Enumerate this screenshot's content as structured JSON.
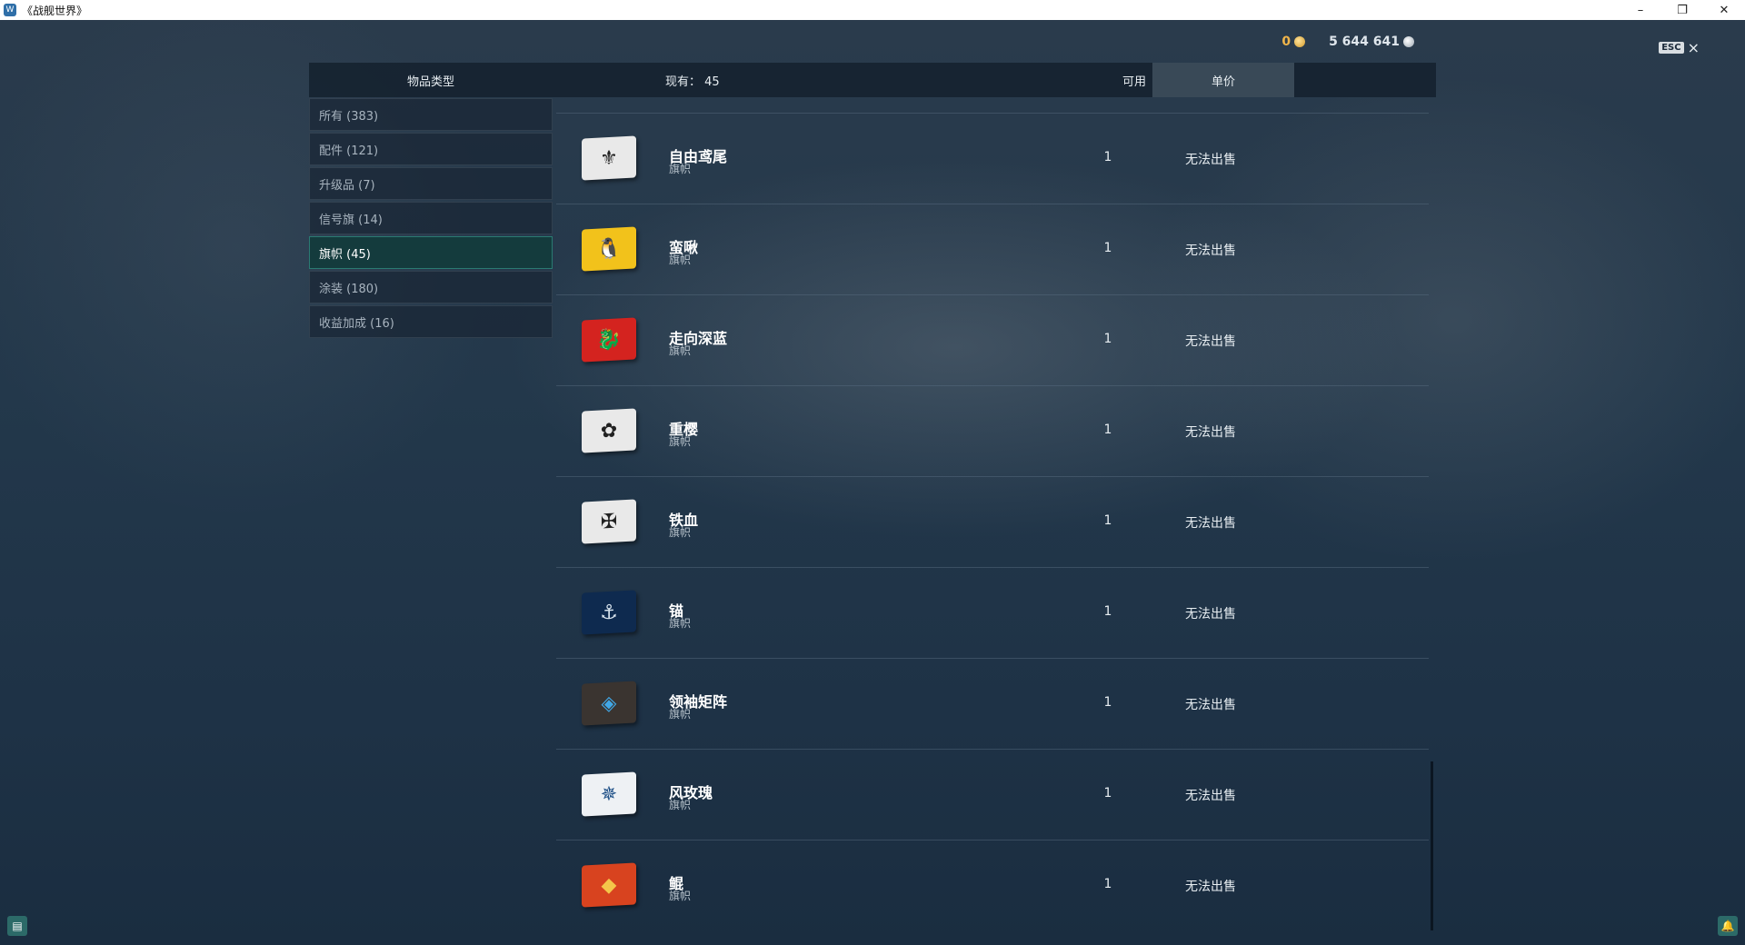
{
  "window": {
    "title": "《战舰世界》",
    "icon": "app-icon",
    "minimize": "–",
    "restore": "❐",
    "close": "✕"
  },
  "currency": {
    "gold": "0",
    "silver": "5 644 641"
  },
  "esc": {
    "key": "ESC",
    "close": "×"
  },
  "header": {
    "category": "物品类型",
    "owned": "现有： 45",
    "available": "可用",
    "unit_price": "单价"
  },
  "sidebar": {
    "items": [
      {
        "label": "所有 (383)"
      },
      {
        "label": "配件 (121)"
      },
      {
        "label": "升级品 (7)"
      },
      {
        "label": "信号旗 (14)"
      },
      {
        "label": "旗帜 (45)",
        "active": true
      },
      {
        "label": "涂装 (180)"
      },
      {
        "label": "收益加成 (16)"
      }
    ]
  },
  "items": [
    {
      "name": "自由鸢尾",
      "type": "旗帜",
      "available": "1",
      "price": "无法出售",
      "icon": "fleur-de-lis-flag-icon",
      "glyph": "⚜",
      "bg": "#e9e9e9",
      "fg": "#222222"
    },
    {
      "name": "蛮啾",
      "type": "旗帜",
      "available": "1",
      "price": "无法出售",
      "icon": "penguin-flag-icon",
      "glyph": "🐧",
      "bg": "#f2c21b",
      "fg": "#222222"
    },
    {
      "name": "走向深蓝",
      "type": "旗帜",
      "available": "1",
      "price": "无法出售",
      "icon": "dragon-flag-icon",
      "glyph": "🐉",
      "bg": "#d4231f",
      "fg": "#f6d24a"
    },
    {
      "name": "重樱",
      "type": "旗帜",
      "available": "1",
      "price": "无法出售",
      "icon": "sakura-flag-icon",
      "glyph": "✿",
      "bg": "#e9e9e9",
      "fg": "#222222"
    },
    {
      "name": "铁血",
      "type": "旗帜",
      "available": "1",
      "price": "无法出售",
      "icon": "iron-cross-flag-icon",
      "glyph": "✠",
      "bg": "#e9e9e9",
      "fg": "#222222"
    },
    {
      "name": "锚",
      "type": "旗帜",
      "available": "1",
      "price": "无法出售",
      "icon": "crossed-anchors-flag-icon",
      "glyph": "⚓",
      "bg": "#0e2a4f",
      "fg": "#d8e4ee"
    },
    {
      "name": "领袖矩阵",
      "type": "旗帜",
      "available": "1",
      "price": "无法出售",
      "icon": "matrix-flag-icon",
      "glyph": "◈",
      "bg": "#3a3430",
      "fg": "#41a7e6"
    },
    {
      "name": "风玫瑰",
      "type": "旗帜",
      "available": "1",
      "price": "无法出售",
      "icon": "compass-rose-flag-icon",
      "glyph": "✵",
      "bg": "#eef1f4",
      "fg": "#1d4f86"
    },
    {
      "name": "鲲",
      "type": "旗帜",
      "available": "1",
      "price": "无法出售",
      "icon": "kun-flag-icon",
      "glyph": "◆",
      "bg": "#d8431f",
      "fg": "#f4c64a"
    }
  ],
  "corner": {
    "chat_icon": "chat-icon",
    "chat_glyph": "▤",
    "notify_icon": "bell-icon",
    "notify_glyph": "🔔"
  }
}
